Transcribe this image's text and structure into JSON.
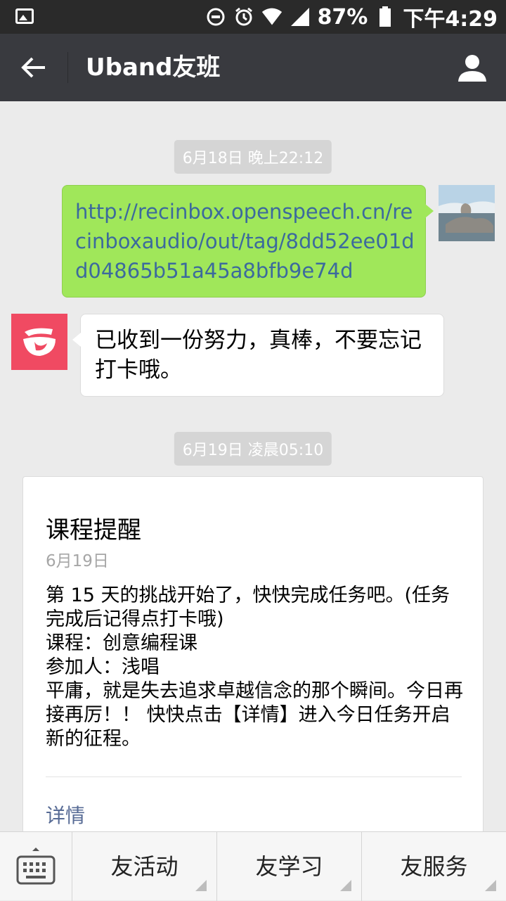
{
  "status_bar": {
    "battery_percent": "87%",
    "time": "下午4:29",
    "icons": [
      "image-icon",
      "dnd-icon",
      "alarm-icon",
      "wifi-icon",
      "signal-icon",
      "battery-icon"
    ]
  },
  "header": {
    "title": "Uband友班",
    "back_icon": "arrow-left-icon",
    "profile_icon": "person-icon"
  },
  "chat": {
    "timestamp_1": "6月18日 晚上22:12",
    "sent_message": "http://recinbox.openspeech.cn/recinboxaudio/out/tag/8dd52ee01dd04865b51a45a8bfb9e74d",
    "reply_message": "已收到一份努力，真棒，不要忘记打卡哦。",
    "timestamp_2": "6月19日 凌晨05:10",
    "card": {
      "title": "课程提醒",
      "date": "6月19日",
      "body_lines": [
        "第 15 天的挑战开始了，快快完成任务吧。(任务完成后记得点打卡哦)",
        "课程：创意编程课",
        "参加人：浅唱",
        "平庸，就是失去追求卓越信念的那个瞬间。今日再接再厉！！ 快快点击【详情】进入今日任务开启新的征程。"
      ],
      "link": "详情"
    }
  },
  "bottom_menu": {
    "keyboard_icon": "keyboard-icon",
    "items": [
      "友活动",
      "友学习",
      "友服务"
    ]
  },
  "colors": {
    "title_bar": "#393a3f",
    "status_bar": "#2a2a2a",
    "sent_bubble": "#a0e75a",
    "link": "#576b95",
    "brand": "#f04a62"
  }
}
